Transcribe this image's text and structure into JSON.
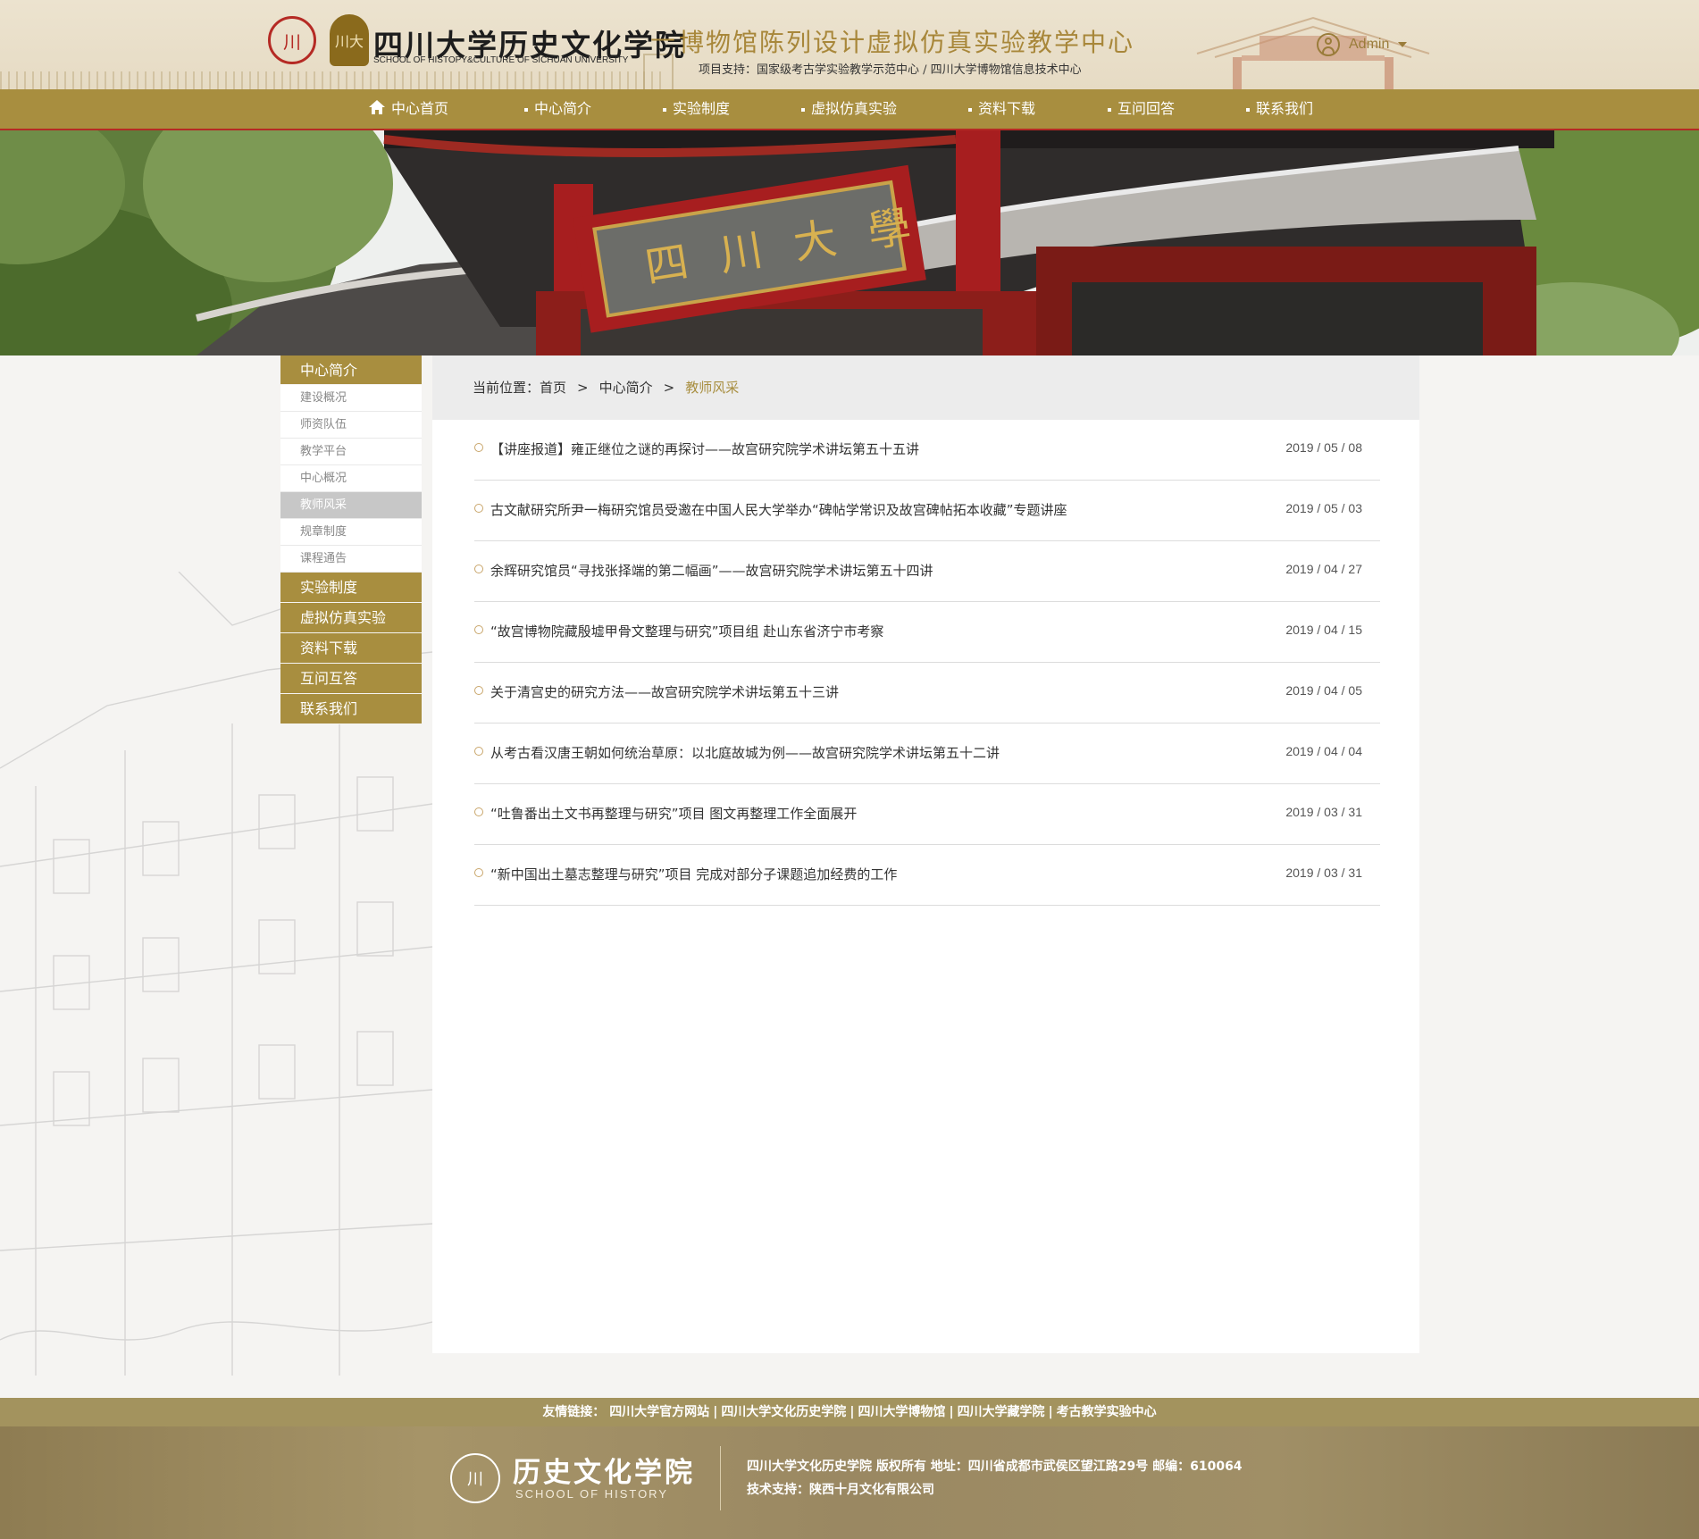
{
  "header": {
    "seal_text": "川",
    "seal2_text": "川大",
    "school_name_cn": "四川大学历史文化学院",
    "school_name_en": "SCHOOL OF HISTOPY&CULTURE OF SICHUAN UNIVERSITY",
    "separator": "—",
    "center_title": "博物馆陈列设计虚拟仿真实验教学中心",
    "support_text": "项目支持：国家级考古学实验教学示范中心 / 四川大学博物馆信息技术中心",
    "user_name": "Admin",
    "icons": {
      "user": "user-avatar-icon",
      "dropdown": "caret-down-icon",
      "home": "home-icon"
    }
  },
  "nav": {
    "items": [
      {
        "label": "中心首页"
      },
      {
        "label": "中心简介"
      },
      {
        "label": "实验制度"
      },
      {
        "label": "虚拟仿真实验"
      },
      {
        "label": "资料下载"
      },
      {
        "label": "互问回答"
      },
      {
        "label": "联系我们"
      }
    ]
  },
  "banner": {
    "plaque_text": "四川大學"
  },
  "sidebar": {
    "head": "中心简介",
    "subitems": [
      "建设概况",
      "师资队伍",
      "教学平台",
      "中心概况",
      "教师风采",
      "规章制度",
      "课程通告"
    ],
    "active_subitem": "教师风采",
    "main_items": [
      "实验制度",
      "虚拟仿真实验",
      "资料下载",
      "互问互答",
      "联系我们"
    ]
  },
  "breadcrumb": {
    "prefix": "当前位置：",
    "items": [
      "首页",
      "中心简介",
      "教师风采"
    ],
    "separator": ">"
  },
  "articles": [
    {
      "title": "【讲座报道】雍正继位之谜的再探讨——故宫研究院学术讲坛第五十五讲",
      "date": "2019 / 05 / 08"
    },
    {
      "title": "古文献研究所尹一梅研究馆员受邀在中国人民大学举办“碑帖学常识及故宫碑帖拓本收藏”专题讲座",
      "date": "2019 / 05 / 03"
    },
    {
      "title": "余辉研究馆员“寻找张择端的第二幅画”——故宫研究院学术讲坛第五十四讲",
      "date": "2019 / 04 / 27"
    },
    {
      "title": "“故宫博物院藏殷墟甲骨文整理与研究”项目组 赴山东省济宁市考察",
      "date": "2019 / 04 / 15"
    },
    {
      "title": "关于清宫史的研究方法——故宫研究院学术讲坛第五十三讲",
      "date": "2019 / 04 / 05"
    },
    {
      "title": "从考古看汉唐王朝如何统治草原：以北庭故城为例——故宫研究院学术讲坛第五十二讲",
      "date": "2019 / 04 / 04"
    },
    {
      "title": "“吐鲁番出土文书再整理与研究”项目 图文再整理工作全面展开",
      "date": "2019 / 03 / 31"
    },
    {
      "title": "“新中国出土墓志整理与研究”项目 完成对部分子课题追加经费的工作",
      "date": "2019 / 03 / 31"
    }
  ],
  "footer": {
    "links_label": "友情链接：",
    "links": [
      "四川大学官方网站",
      "四川大学文化历史学院",
      "四川大学博物馆",
      "四川大学藏学院",
      "考古教学实验中心"
    ],
    "link_separator": "|",
    "seal_text": "川",
    "name_cn": "历史文化学院",
    "name_en": "SCHOOL OF HISTORY",
    "copyright": "四川大学文化历史学院 版权所有  地址：四川省成都市武侯区望江路29号  邮编：610064",
    "tech_support": "技术支持：陕西十月文化有限公司"
  },
  "colors": {
    "gold": "#a88e3f",
    "red": "#b52a24",
    "accent_text": "#a8873a"
  }
}
